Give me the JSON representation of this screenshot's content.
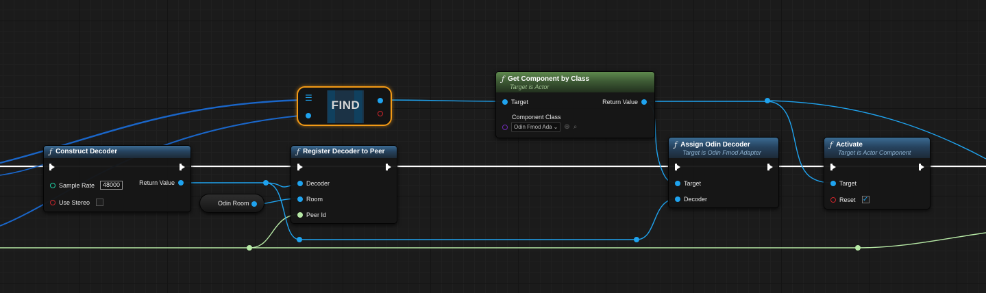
{
  "nodes": {
    "construct_decoder": {
      "title": "Construct Decoder",
      "sample_rate_label": "Sample Rate",
      "sample_rate_value": "48000",
      "use_stereo_label": "Use Stereo",
      "use_stereo_checked": false,
      "return_value_label": "Return Value"
    },
    "find": {
      "label": "FIND"
    },
    "odin_room": {
      "label": "Odin Room"
    },
    "register_decoder": {
      "title": "Register Decoder to Peer",
      "decoder_label": "Decoder",
      "room_label": "Room",
      "peer_id_label": "Peer Id"
    },
    "get_component": {
      "title": "Get Component by Class",
      "subtitle": "Target is Actor",
      "target_label": "Target",
      "return_value_label": "Return Value",
      "component_class_label": "Component Class",
      "component_class_value": "Odin Fmod Ada"
    },
    "assign_decoder": {
      "title": "Assign Odin Decoder",
      "subtitle": "Target is Odin Fmod Adapter",
      "target_label": "Target",
      "decoder_label": "Decoder"
    },
    "activate": {
      "title": "Activate",
      "subtitle": "Target is Actor Component",
      "target_label": "Target",
      "reset_label": "Reset",
      "reset_checked": true
    }
  },
  "colors": {
    "exec": "#ffffff",
    "object_pin": "#1fa3ef",
    "struct_pin": "#b7e9a6",
    "bool_pin": "#c7252b",
    "int_pin": "#1fd1a5",
    "class_pin": "#6f2bb5",
    "find_highlight": "#f39a16",
    "function_header": "#3b6b93",
    "pure_header": "#5f8a4e"
  }
}
